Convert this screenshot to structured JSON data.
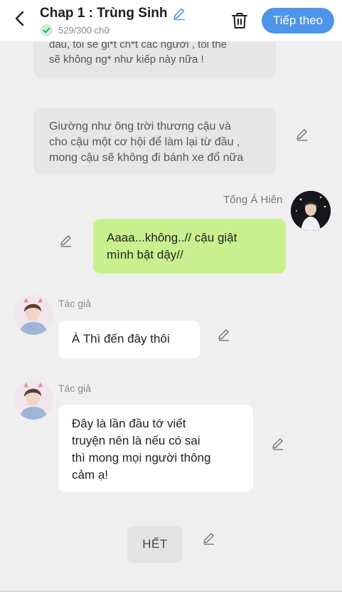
{
  "header": {
    "title": "Chap 1 : Trùng Sinh",
    "word_count": "529/300 chữ",
    "next_label": "Tiếp theo",
    "accent": "#4d95ea"
  },
  "messages": {
    "partial": {
      "lines": [
        "đầu,  tôi sẽ gi*t ch*t các người  , tôi thề",
        "sẽ không ng* như kiếp này nữa !"
      ]
    },
    "narration": {
      "lines": [
        "Giường như ông trời thương cậu và",
        "cho cậu một cơ hội để làm lại từ đầu ,",
        "mong cậu sẽ không đi bánh xe đổ nữa"
      ]
    },
    "character": {
      "name": "Tống Á Hiên",
      "lines": [
        "Aaaa...không..// cậu giật",
        "mình bật dậy//"
      ],
      "bubble_color": "#c9f08f"
    },
    "author1": {
      "name": "Tác giả",
      "lines": [
        "À Thì đến đây thôi"
      ]
    },
    "author2": {
      "name": "Tác giả",
      "lines": [
        "Đây là lần đầu tớ viết",
        "truyện nên là nếu có sai",
        "thì mong mọi người thông",
        "cảm ạ!"
      ]
    }
  },
  "end_label": "HẾT",
  "icons": [
    "back-arrow-icon",
    "edit-pencil-icon",
    "check-circle-icon",
    "trash-icon",
    "avatar"
  ]
}
